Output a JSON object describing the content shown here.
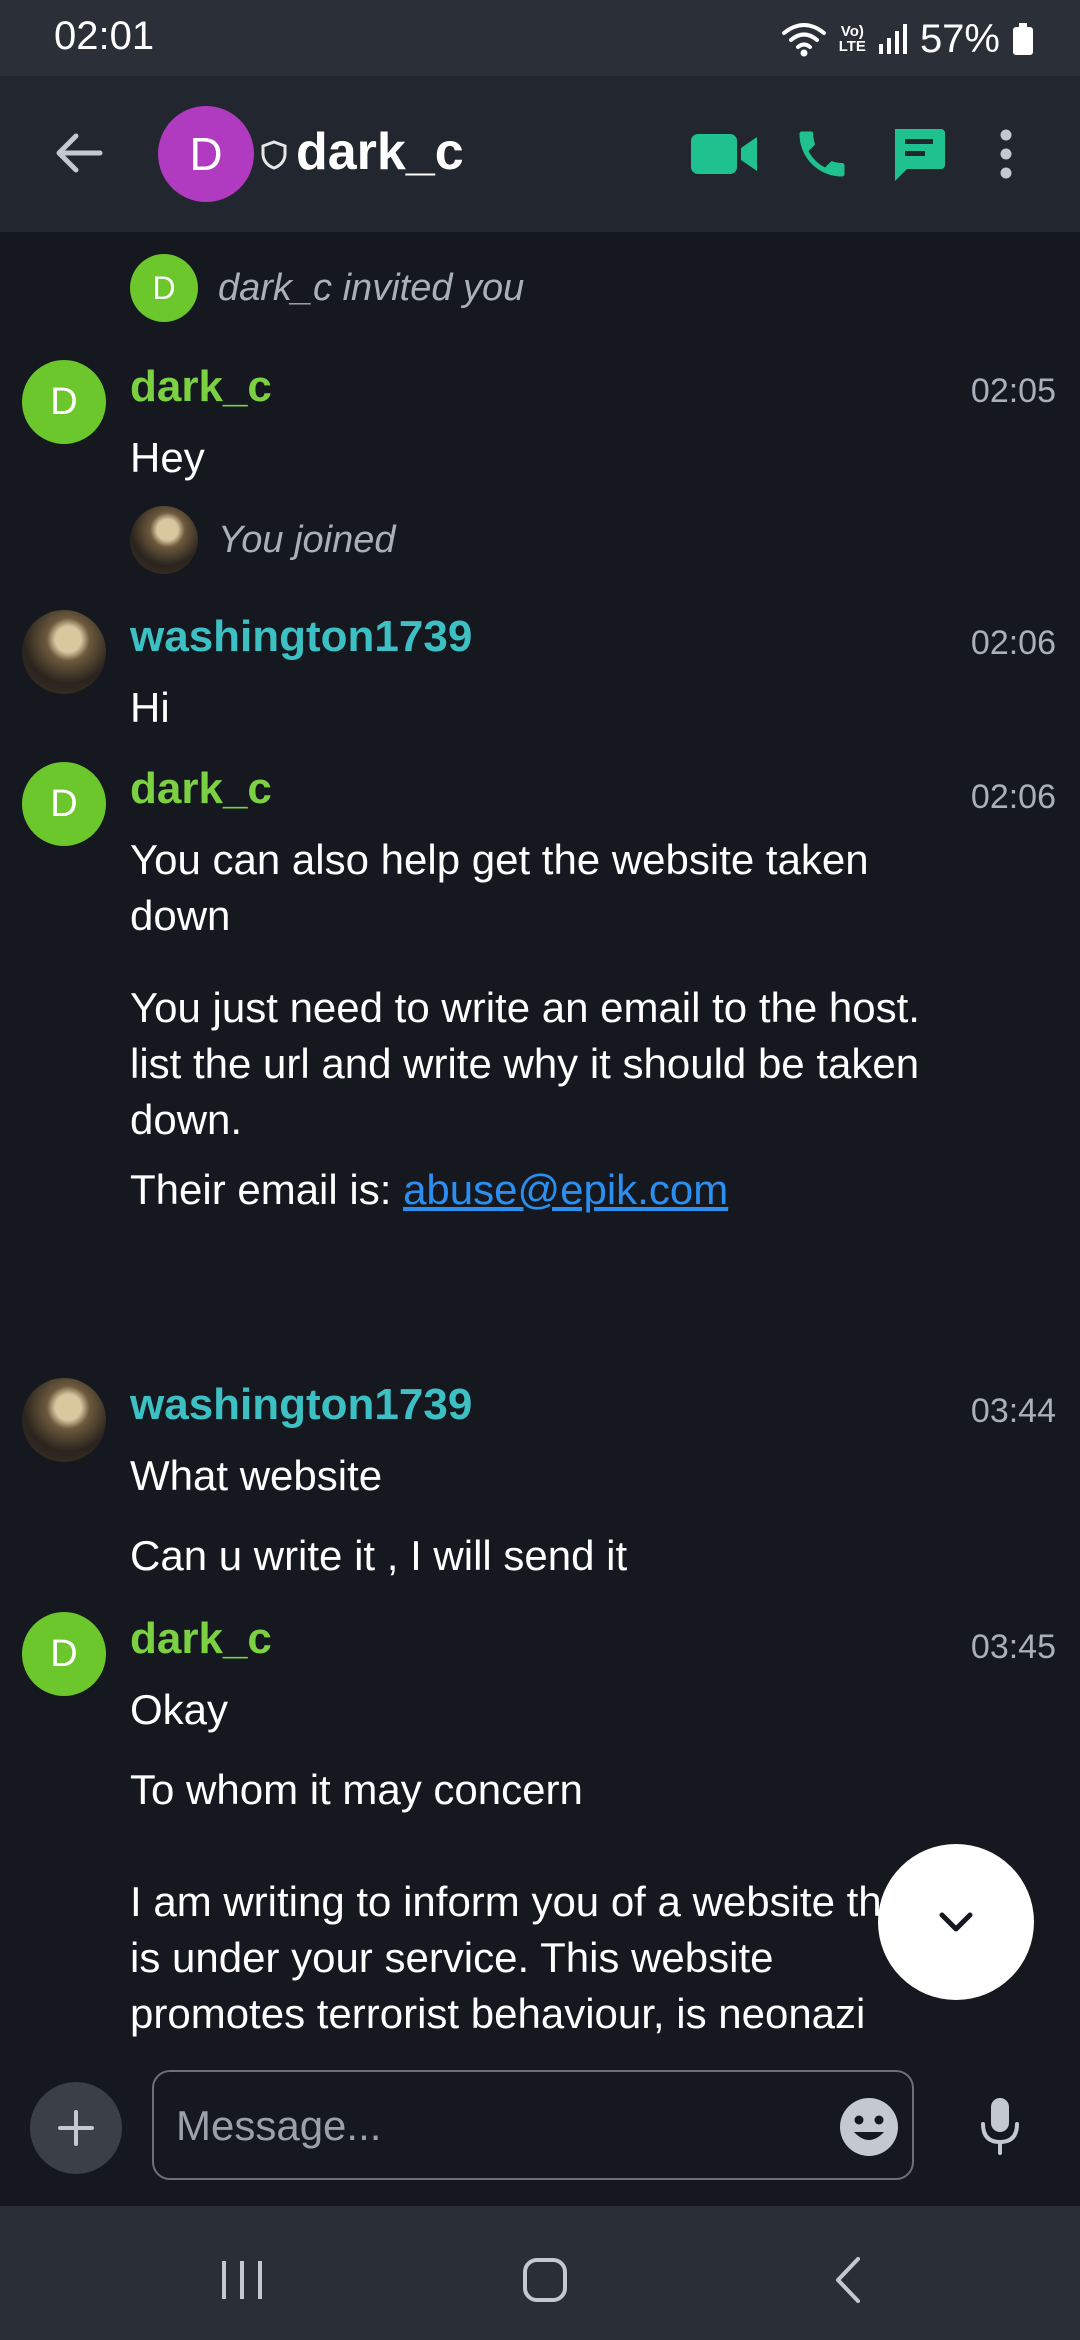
{
  "status_bar": {
    "time": "02:01",
    "volte_top": "Vo)",
    "volte_bottom": "LTE",
    "battery_percent": "57%"
  },
  "header": {
    "avatar_letter": "D",
    "title": "dark_c"
  },
  "events": [
    {
      "avatar_letter": "D",
      "text": "dark_c invited you"
    },
    {
      "text": "You joined"
    }
  ],
  "messages": [
    {
      "sender": "dark_c",
      "time": "02:05",
      "avatar_letter": "D",
      "lines": [
        "Hey"
      ]
    },
    {
      "sender": "washington1739",
      "time": "02:06",
      "lines": [
        "Hi"
      ]
    },
    {
      "sender": "dark_c",
      "time": "02:06",
      "avatar_letter": "D",
      "lines": [
        "You can also help get the website taken down",
        "You just need to write an email to the host. list the url and write why it should be taken down."
      ],
      "email_prefix": "Their email is: ",
      "email_link": "abuse@epik.com"
    },
    {
      "sender": "washington1739",
      "time": "03:44",
      "lines": [
        "What website",
        "Can u write it , I will send it"
      ]
    },
    {
      "sender": "dark_c",
      "time": "03:45",
      "avatar_letter": "D",
      "lines": [
        "Okay",
        "To whom it may concern",
        "I am writing to inform you of a website that is under your service. This website promotes terrorist behaviour, is neonazi"
      ]
    }
  ],
  "composer": {
    "placeholder": "Message..."
  },
  "colors": {
    "background": "#15181e",
    "header": "#22262e",
    "accent": "#1fc28f",
    "sender_green": "#7bd142",
    "sender_teal": "#3cc0c4",
    "link": "#2a8ff0",
    "header_avatar": "#b13bc0"
  },
  "icons": [
    "back-arrow-icon",
    "shield-icon",
    "video-call-icon",
    "phone-icon",
    "threads-icon",
    "more-vertical-icon",
    "chevron-down-icon",
    "plus-icon",
    "emoji-icon",
    "microphone-icon",
    "recents-icon",
    "home-icon",
    "nav-back-icon"
  ]
}
